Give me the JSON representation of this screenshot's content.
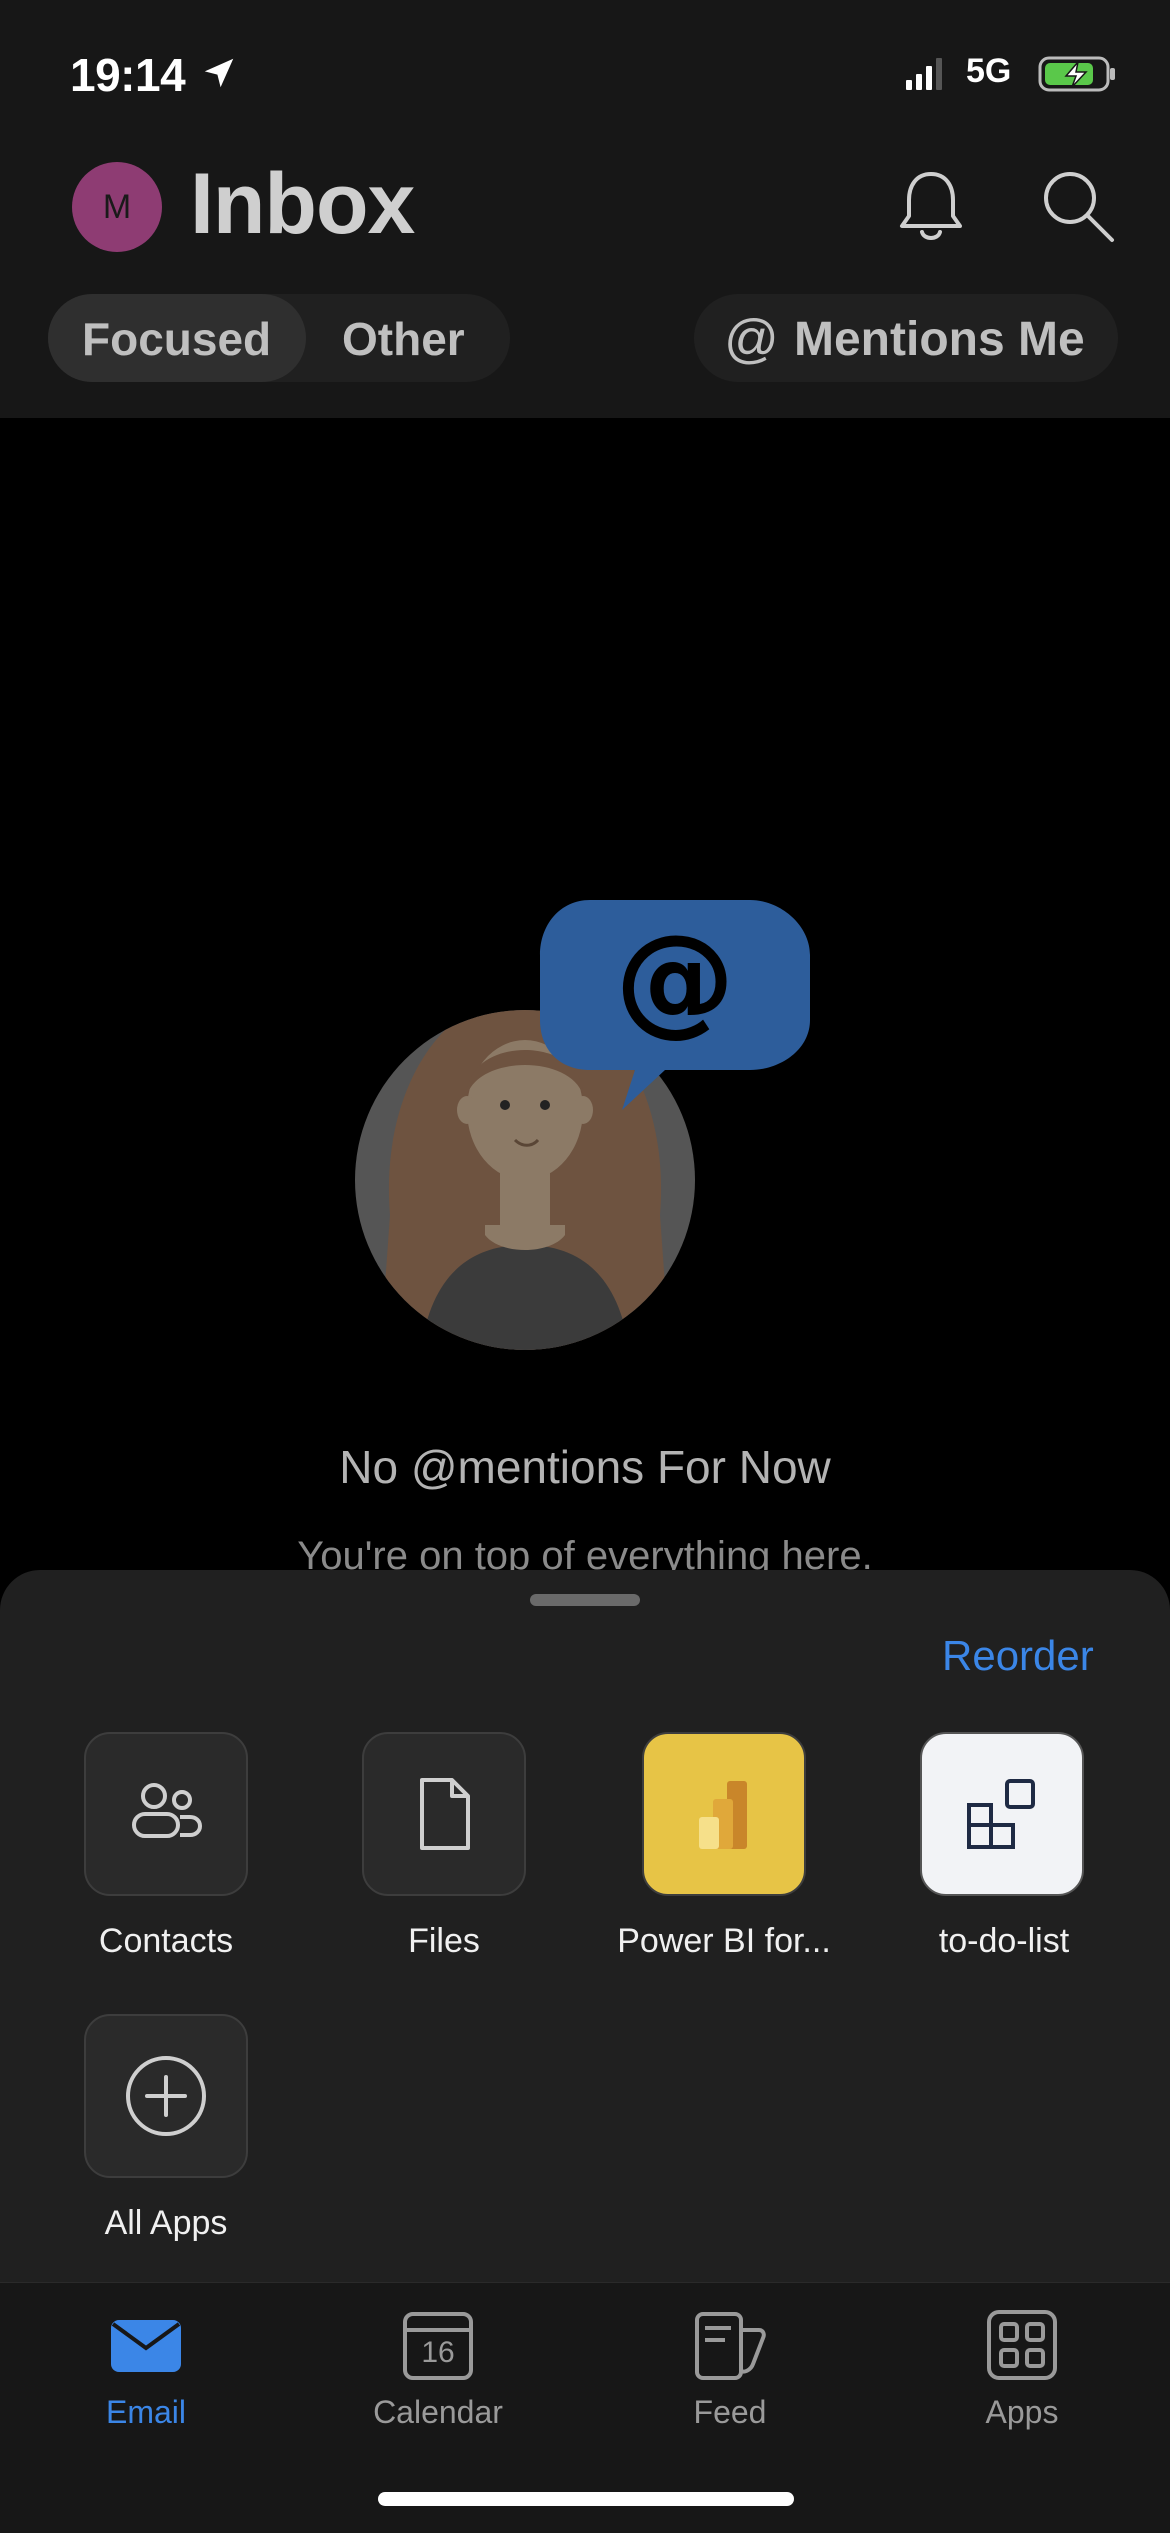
{
  "status": {
    "time": "19:14",
    "network": "5G"
  },
  "header": {
    "avatar_initial": "M",
    "title": "Inbox"
  },
  "filters": {
    "focused": "Focused",
    "other": "Other",
    "mentions_at": "@",
    "mentions_label": "Mentions Me"
  },
  "empty_state": {
    "title": "No @mentions For Now",
    "subtitle": "You're on top of everything here."
  },
  "sheet": {
    "reorder": "Reorder",
    "apps": [
      {
        "label": "Contacts",
        "icon": "contacts-icon"
      },
      {
        "label": "Files",
        "icon": "file-icon"
      },
      {
        "label": "Power BI for...",
        "icon": "power-bi-icon"
      },
      {
        "label": "to-do-list",
        "icon": "todo-icon"
      },
      {
        "label": "All Apps",
        "icon": "add-circle-icon"
      }
    ]
  },
  "tabs": [
    {
      "label": "Email",
      "icon": "mail-icon",
      "active": true
    },
    {
      "label": "Calendar",
      "icon": "calendar-icon",
      "day": "16"
    },
    {
      "label": "Feed",
      "icon": "feed-icon"
    },
    {
      "label": "Apps",
      "icon": "apps-icon"
    }
  ],
  "colors": {
    "accent": "#3b86e7",
    "avatar": "#8e3c73",
    "powerbi": "#e7c446",
    "speech_bubble": "#2d5d9b"
  }
}
